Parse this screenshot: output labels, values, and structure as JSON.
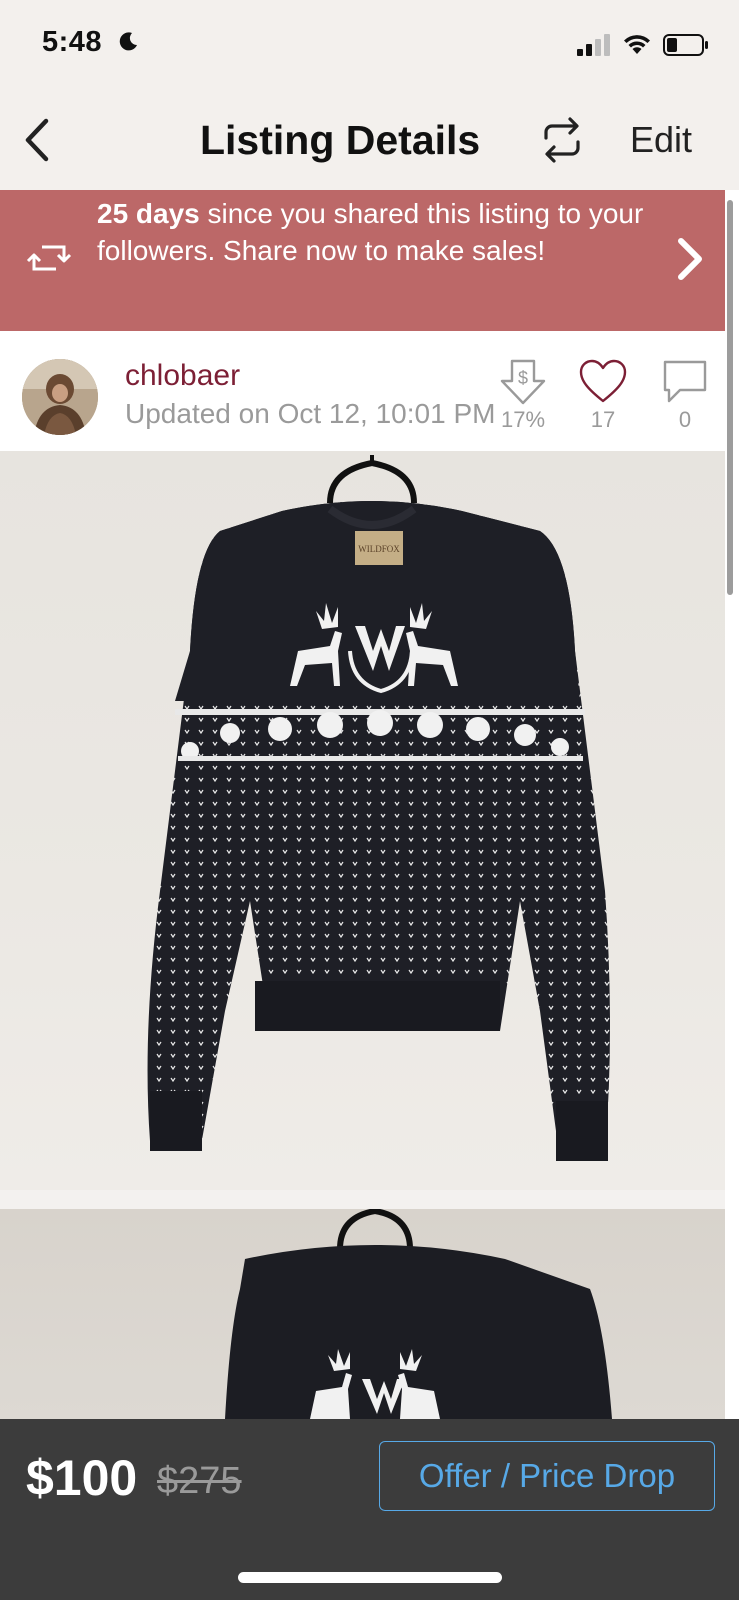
{
  "status_bar": {
    "time": "5:48"
  },
  "nav": {
    "title": "Listing Details",
    "edit_label": "Edit"
  },
  "share_banner": {
    "days": "25 days",
    "text_after_days": " since you shared this listing to your followers. Share now to make sales!"
  },
  "seller": {
    "username": "chlobaer",
    "updated": "Updated on Oct 12, 10:01 PM",
    "price_drop_percent": "17%",
    "likes": "17",
    "comments": "0"
  },
  "listing": {
    "label_text": "WILDFOX",
    "price": "$100",
    "original_price": "$275",
    "offer_button_label": "Offer / Price Drop"
  },
  "colors": {
    "banner": "#bc6868",
    "seller_name": "#7c1f35",
    "offer_blue": "#57a9e7",
    "bottom_bar": "#3c3c3c"
  }
}
